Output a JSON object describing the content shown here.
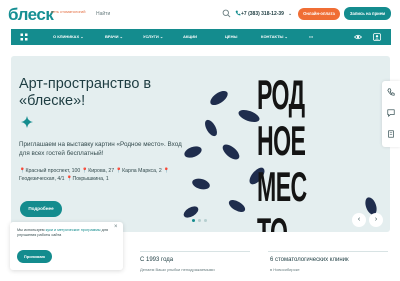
{
  "header": {
    "logo": "блеск",
    "logo_sub": "сеть стоматологий",
    "search_placeholder": "Найти",
    "phone": "+7 (383) 318-12-39",
    "online_button": "Онлайн-оплата",
    "book_button": "Запись на прием"
  },
  "nav": {
    "items": [
      "О клиниках",
      "Врачи",
      "Услуги",
      "Акции",
      "Цены",
      "Контакты"
    ]
  },
  "hero": {
    "title": "Арт-пространство в «блеске»!",
    "text": "Приглашаем на выставку картин «Родное место». Вход для всех гостей бесплатный!",
    "addresses": [
      "Красный проспект, 100",
      "Кирова, 27",
      "Карла Маркса, 2",
      "Геодезическая, 4/1",
      "Покрышкина, 1"
    ],
    "more_button": "Подробнее",
    "art_lines": [
      "РОД",
      "НОЕ",
      "МЕС",
      "ТО"
    ],
    "prev_arrow": "‹",
    "next_arrow": "›",
    "slide_count": 3,
    "active_slide": 1
  },
  "cookie": {
    "text_before": "Мы используем ",
    "link_text": "куки и метрические программы",
    "text_after": " для улучшения работы сайта",
    "accept_button": "Принимаю",
    "close": "×"
  },
  "stats": [
    {
      "title": "С 1993 года",
      "subtitle": "Делаем Ваши улыбки неподражаемыми"
    },
    {
      "title": "6 стоматологических клиник",
      "subtitle": "в Новосибирске"
    }
  ],
  "colors": {
    "brand": "#148c8e",
    "accent": "#f06e35",
    "hero_bg": "#e4eeef"
  }
}
